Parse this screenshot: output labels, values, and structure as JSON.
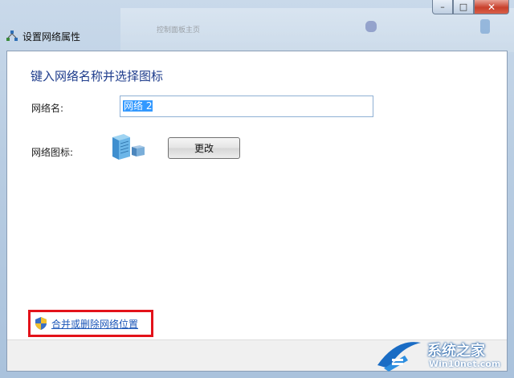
{
  "window": {
    "title": "设置网络属性",
    "caption_buttons": {
      "minimize": "–",
      "maximize": "□",
      "close": "✕"
    },
    "background_text": "控制面板主页"
  },
  "dialog": {
    "heading": "键入网络名称并选择图标",
    "name_label": "网络名:",
    "name_value": "网络  2",
    "icon_label": "网络图标:",
    "icon_name": "network-building-icon",
    "change_button": "更改",
    "merge_link": "合并或删除网络位置"
  },
  "watermark": {
    "cn": "系统之家",
    "en": "Win10net.com"
  },
  "colors": {
    "heading": "#1e3c8c",
    "link": "#1b56b8",
    "highlight_box": "#e3121a",
    "selection": "#3399ff"
  }
}
